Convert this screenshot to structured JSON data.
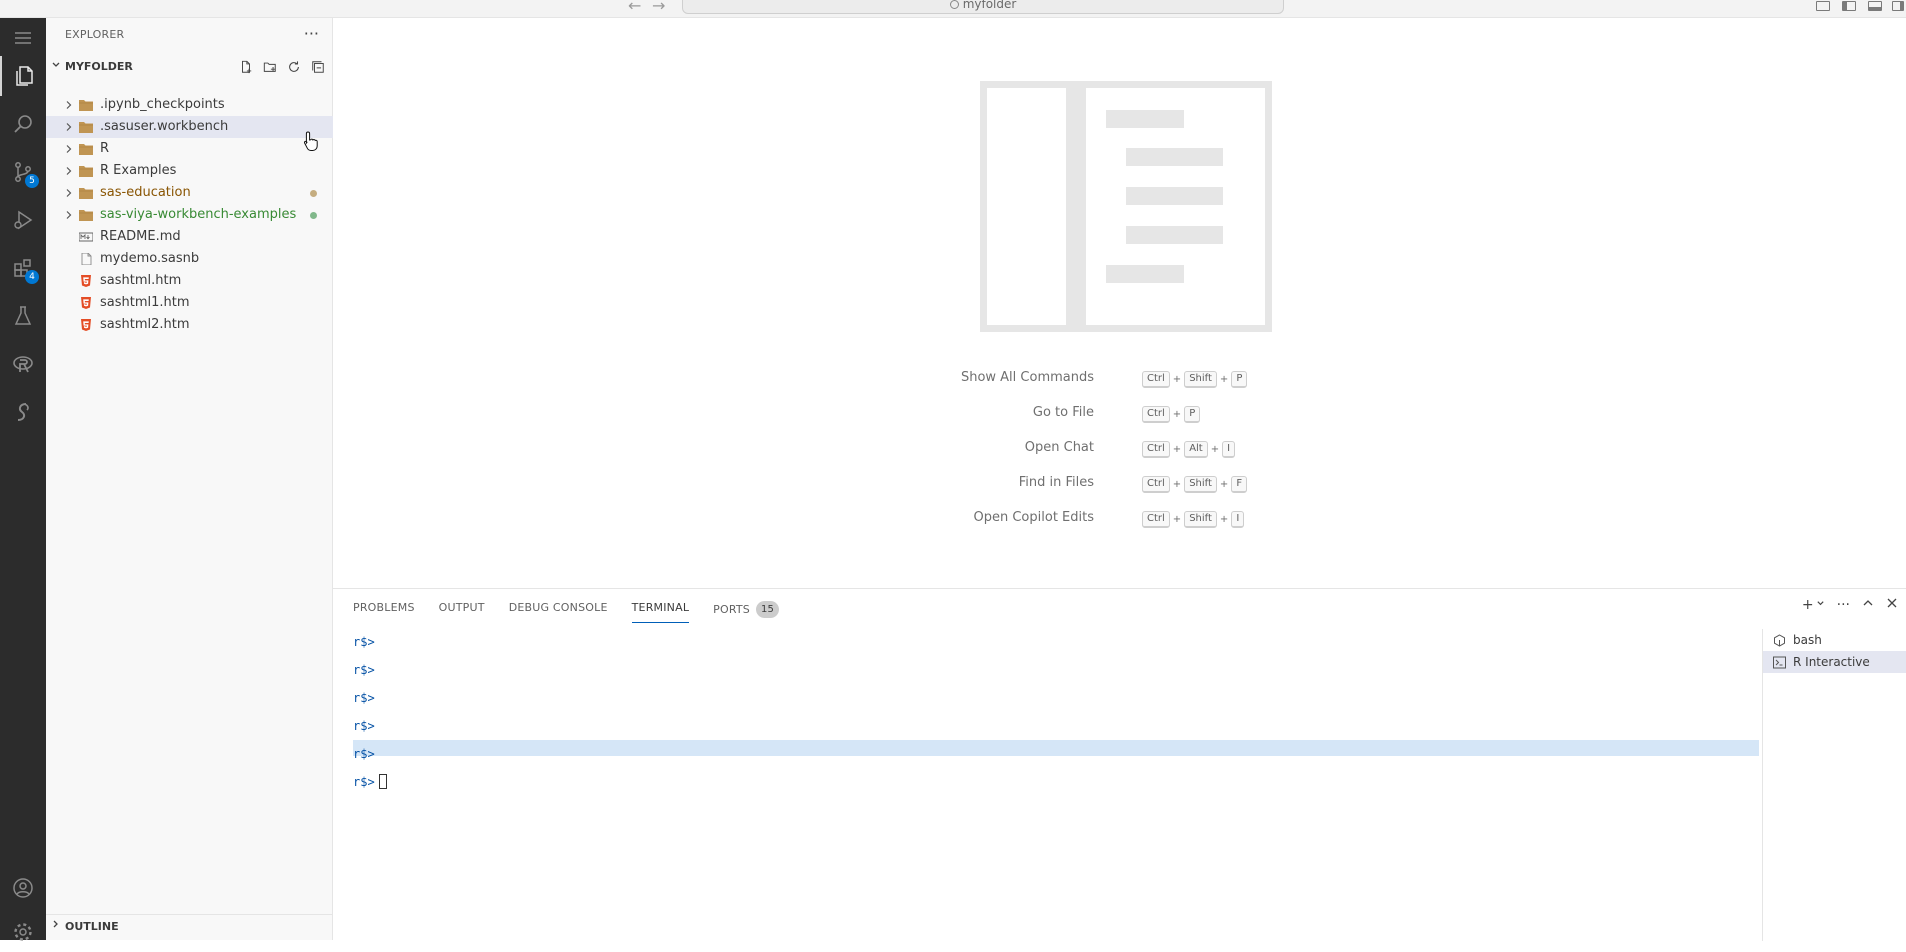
{
  "titlebar": {
    "search_text": "myfolder"
  },
  "activity": {
    "source_control_badge": "5",
    "extensions_badge": "4"
  },
  "sidebar": {
    "title": "EXPLORER",
    "more_label": "···",
    "folder_name": "MYFOLDER",
    "outline_label": "OUTLINE",
    "items": [
      {
        "label": ".ipynb_checkpoints",
        "type": "folder",
        "color": "#3b3b3b"
      },
      {
        "label": ".sasuser.workbench",
        "type": "folder",
        "color": "#3b3b3b"
      },
      {
        "label": "R",
        "type": "folder",
        "color": "#3b3b3b"
      },
      {
        "label": "R Examples",
        "type": "folder",
        "color": "#3b3b3b"
      },
      {
        "label": "sas-education",
        "type": "folder",
        "color": "#895503",
        "dot_color": "#c5ad80"
      },
      {
        "label": "sas-viya-workbench-examples",
        "type": "folder",
        "color": "#388a34",
        "dot_color": "#81b88b"
      },
      {
        "label": "README.md",
        "type": "markdown",
        "color": "#3b3b3b"
      },
      {
        "label": "mydemo.sasnb",
        "type": "file",
        "color": "#3b3b3b"
      },
      {
        "label": "sashtml.htm",
        "type": "html",
        "color": "#3b3b3b"
      },
      {
        "label": "sashtml1.htm",
        "type": "html",
        "color": "#3b3b3b"
      },
      {
        "label": "sashtml2.htm",
        "type": "html",
        "color": "#3b3b3b"
      }
    ]
  },
  "editor": {
    "shortcuts": [
      {
        "label": "Show All Commands",
        "keys": [
          "Ctrl",
          "Shift",
          "P"
        ]
      },
      {
        "label": "Go to File",
        "keys": [
          "Ctrl",
          "P"
        ]
      },
      {
        "label": "Open Chat",
        "keys": [
          "Ctrl",
          "Alt",
          "I"
        ]
      },
      {
        "label": "Find in Files",
        "keys": [
          "Ctrl",
          "Shift",
          "F"
        ]
      },
      {
        "label": "Open Copilot Edits",
        "keys": [
          "Ctrl",
          "Shift",
          "I"
        ]
      }
    ],
    "plus_sign": "+"
  },
  "panel": {
    "tabs": {
      "problems": "PROBLEMS",
      "output": "OUTPUT",
      "debug_console": "DEBUG CONSOLE",
      "terminal": "TERMINAL",
      "ports": "PORTS",
      "ports_count": "15"
    },
    "terminal_lines": [
      "r$>",
      "r$>",
      "r$>",
      "r$>",
      "r$>",
      "r$>"
    ],
    "terminals": [
      {
        "label": "bash",
        "icon": "bash-icon"
      },
      {
        "label": "R Interactive",
        "icon": "terminal-icon"
      }
    ]
  }
}
